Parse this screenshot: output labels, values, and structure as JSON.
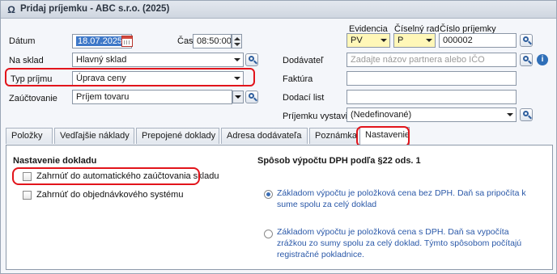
{
  "window": {
    "title": "Pridaj príjemku - ABC s.r.o. (2025)"
  },
  "form": {
    "datum_label": "Dátum",
    "datum_value": "18.07.2025",
    "cas_label": "Čas",
    "cas_value": "08:50:00",
    "na_sklad_label": "Na sklad",
    "na_sklad_value": "Hlavný sklad",
    "typ_prijmu_label": "Typ príjmu",
    "typ_prijmu_value": "Úprava ceny",
    "zauctovanie_label": "Zaúčtovanie",
    "zauctovanie_value": "Príjem tovaru",
    "evidencia_label": "Evidencia",
    "evidencia_value": "PV",
    "ciselny_rad_label": "Číselný rad",
    "ciselny_rad_value": "P",
    "cislo_prijemky_label": "Číslo príjemky",
    "cislo_prijemky_value": "000002",
    "dodavatel_label": "Dodávateľ",
    "dodavatel_placeholder": "Zadajte názov partnera alebo IČO",
    "faktura_label": "Faktúra",
    "faktura_value": "",
    "dodaci_list_label": "Dodací list",
    "dodaci_list_value": "",
    "vystavil_label": "Príjemku vystavil",
    "vystavil_value": "(Nedefinované)"
  },
  "tabs": [
    "Položky",
    "Vedľajšie náklady",
    "Prepojené doklady",
    "Adresa dodávateľa",
    "Poznámka",
    "Nastavenie"
  ],
  "active_tab": "Nastavenie",
  "settings": {
    "doc_title": "Nastavenie dokladu",
    "cb_auto": "Zahrnúť do automatického zaúčtovania skladu",
    "cb_orders": "Zahrnúť do objednávkového systému",
    "vat_title": "Spôsob výpočtu DPH podľa §22 ods. 1",
    "radio1_line1": "Základom výpočtu je položková cena bez DPH. Daň sa pripočíta k",
    "radio1_line2": "sume spolu za celý doklad",
    "radio2_line1": "Základom výpočtu je položková cena s DPH. Daň sa vypočíta",
    "radio2_line2": "zrážkou zo sumy spolu za celý doklad. Týmto spôsobom počítajú",
    "radio2_line3": "registračné pokladnice."
  },
  "colors": {
    "highlight": "#e2141b",
    "link_blue": "#2a58a8",
    "selection": "#3e78c8",
    "required_field": "#fff7b8"
  },
  "icons": [
    "app-icon",
    "calendar-icon",
    "search-lookup-icon",
    "info-icon",
    "chevron-down-icon"
  ]
}
